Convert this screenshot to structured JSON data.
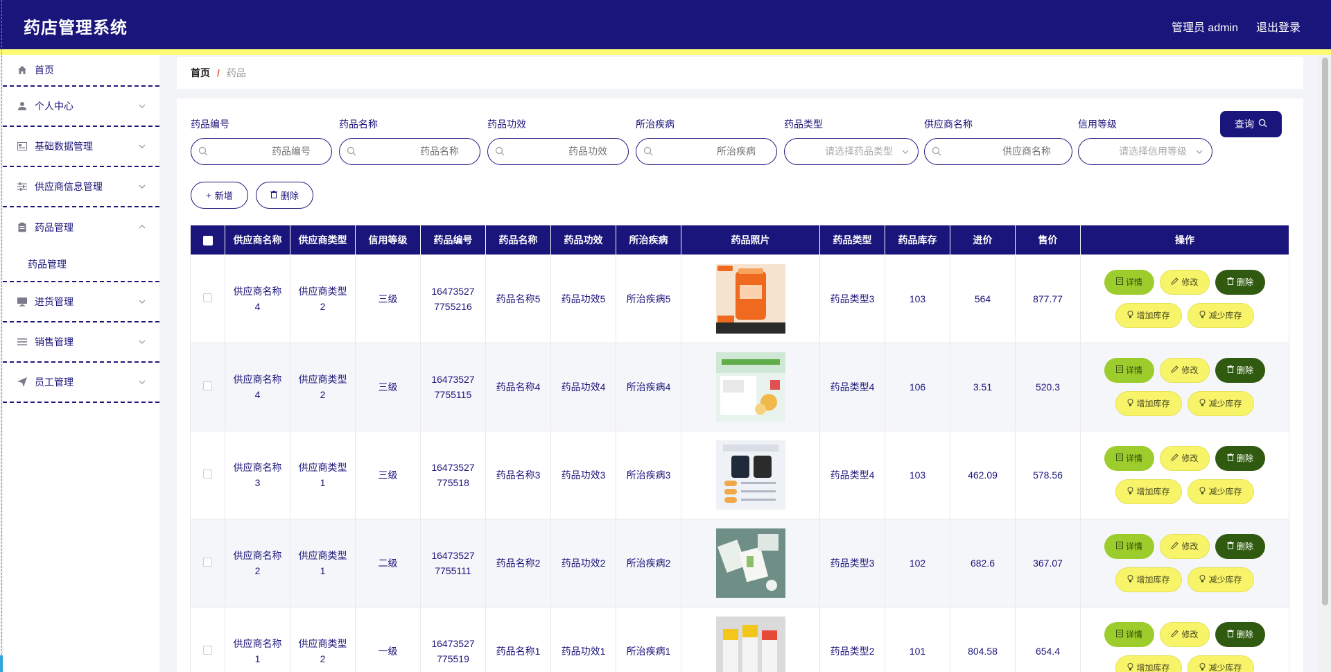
{
  "header": {
    "title": "药店管理系统",
    "user": "管理员 admin",
    "logout": "退出登录"
  },
  "sidebar": {
    "items": [
      {
        "label": "首页",
        "icon": "home-icon"
      },
      {
        "label": "个人中心",
        "icon": "user-icon"
      },
      {
        "label": "基础数据管理",
        "icon": "card-icon"
      },
      {
        "label": "供应商信息管理",
        "icon": "sliders-icon"
      },
      {
        "label": "药品管理",
        "icon": "clipboard-icon",
        "expanded": true,
        "children": [
          {
            "label": "药品管理"
          }
        ]
      },
      {
        "label": "进货管理",
        "icon": "monitor-icon"
      },
      {
        "label": "销售管理",
        "icon": "list-icon"
      },
      {
        "label": "员工管理",
        "icon": "send-icon"
      }
    ]
  },
  "breadcrumb": {
    "home": "首页",
    "sep": "/",
    "current": "药品"
  },
  "search": {
    "fields": [
      {
        "label": "药品编号",
        "placeholder": "药品编号",
        "type": "input"
      },
      {
        "label": "药品名称",
        "placeholder": "药品名称",
        "type": "input"
      },
      {
        "label": "药品功效",
        "placeholder": "药品功效",
        "type": "input"
      },
      {
        "label": "所治疾病",
        "placeholder": "所治疾病",
        "type": "input"
      },
      {
        "label": "药品类型",
        "placeholder": "请选择药品类型",
        "type": "select"
      },
      {
        "label": "供应商名称",
        "placeholder": "供应商名称",
        "type": "input"
      },
      {
        "label": "信用等级",
        "placeholder": "请选择信用等级",
        "type": "select"
      }
    ],
    "query_label": "查询"
  },
  "actions": {
    "add": "新增",
    "delete": "删除"
  },
  "table": {
    "columns": [
      "",
      "供应商名称",
      "供应商类型",
      "信用等级",
      "药品编号",
      "药品名称",
      "药品功效",
      "所治疾病",
      "药品照片",
      "药品类型",
      "药品库存",
      "进价",
      "售价",
      "操作"
    ],
    "op_labels": {
      "detail": "详情",
      "edit": "修改",
      "delete": "删除",
      "add_stock": "增加库存",
      "reduce_stock": "减少库存"
    },
    "rows": [
      {
        "supplier": [
          "供应商名称",
          "4"
        ],
        "supplier_type": [
          "供应商类型",
          "2"
        ],
        "credit": "三级",
        "code": [
          "16473527",
          "7755216"
        ],
        "name": "药品名称5",
        "effect": "药品功效5",
        "disease": "所治疾病5",
        "image_alt": "orange-supplement-bottle",
        "type": "药品类型3",
        "stock": "103",
        "cost": "564",
        "price": "877.77"
      },
      {
        "supplier": [
          "供应商名称",
          "4"
        ],
        "supplier_type": [
          "供应商类型",
          "2"
        ],
        "credit": "三级",
        "code": [
          "16473527",
          "7755115"
        ],
        "name": "药品名称4",
        "effect": "药品功效4",
        "disease": "所治疾病4",
        "image_alt": "vitamin-c-box",
        "type": "药品类型4",
        "stock": "106",
        "cost": "3.51",
        "price": "520.3"
      },
      {
        "supplier": [
          "供应商名称",
          "3"
        ],
        "supplier_type": [
          "供应商类型",
          "1"
        ],
        "credit": "三级",
        "code": [
          "16473527",
          "775518"
        ],
        "name": "药品名称3",
        "effect": "药品功效3",
        "disease": "所治疾病3",
        "image_alt": "supplement-jars",
        "type": "药品类型4",
        "stock": "103",
        "cost": "462.09",
        "price": "578.56"
      },
      {
        "supplier": [
          "供应商名称",
          "2"
        ],
        "supplier_type": [
          "供应商类型",
          "1"
        ],
        "credit": "二级",
        "code": [
          "16473527",
          "7755111"
        ],
        "name": "药品名称2",
        "effect": "药品功效2",
        "disease": "所治疾病2",
        "image_alt": "green-packaging",
        "type": "药品类型3",
        "stock": "102",
        "cost": "682.6",
        "price": "367.07"
      },
      {
        "supplier": [
          "供应商名称",
          "1"
        ],
        "supplier_type": [
          "供应商类型",
          "2"
        ],
        "credit": "一级",
        "code": [
          "16473527",
          "775519"
        ],
        "name": "药品名称1",
        "effect": "药品功效1",
        "disease": "所治疾病1",
        "image_alt": "yellow-medicine-boxes",
        "type": "药品类型2",
        "stock": "101",
        "cost": "804.58",
        "price": "654.4"
      }
    ]
  },
  "colors": {
    "primary": "#1a157a",
    "stripe": "#fdfb73",
    "detail_btn": "#9ccd2c",
    "edit_btn": "#f8f46a",
    "delete_btn": "#2f5a10"
  }
}
